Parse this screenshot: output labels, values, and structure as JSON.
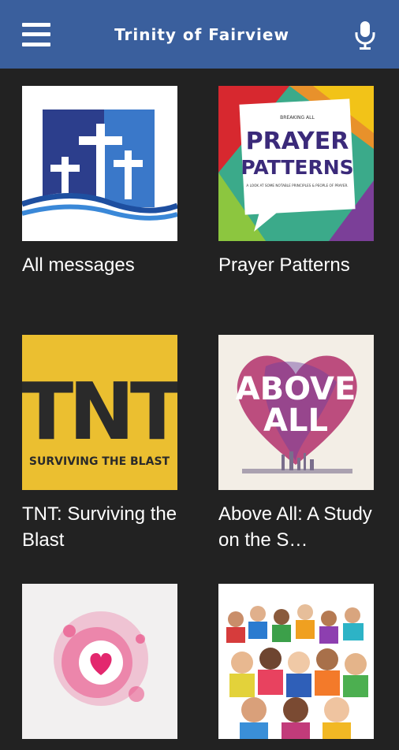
{
  "app": {
    "title": "Trinity of Fairview",
    "menu_icon": "hamburger-menu-icon",
    "mic_icon": "microphone-icon"
  },
  "colors": {
    "appbar": "#3A5F9D",
    "background": "#222222",
    "text": "#FFFFFF"
  },
  "series": [
    {
      "label": "All messages",
      "art": "crosses-logo"
    },
    {
      "label": "Prayer Patterns",
      "art": "prayer-patterns-cover",
      "art_title_1": "PRAYER",
      "art_title_2": "PATTERNS",
      "art_kicker": "BREAKING ALL",
      "art_sub": "A LOOK AT SOME NOTABLE PRINCIPLES & PEOPLE OF PRAYER."
    },
    {
      "label": "TNT: Surviving the Blast",
      "art": "tnt-cover",
      "art_title": "TNT",
      "art_sub": "SURVIVING THE BLAST"
    },
    {
      "label": "Above All: A Study on the S…",
      "art": "above-all-cover",
      "art_title_1": "ABOVE",
      "art_title_2": "ALL"
    },
    {
      "label": "",
      "art": "heart-splash-cover"
    },
    {
      "label": "",
      "art": "people-crowd-cover"
    }
  ]
}
